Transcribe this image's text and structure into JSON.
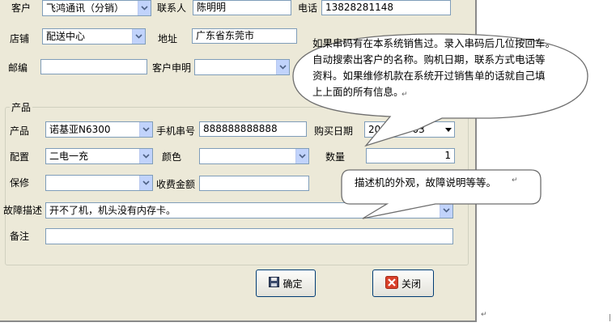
{
  "form": {
    "customer_label": "客户",
    "customer_value": "飞鸿通讯（分销）",
    "contact_label": "联系人",
    "contact_value": "陈明明",
    "phone_label": "电话",
    "phone_value": "13828281148",
    "store_label": "店铺",
    "store_value": "配送中心",
    "address_label": "地址",
    "address_value": "广东省东莞市",
    "zip_label": "邮编",
    "zip_value": "",
    "claim_label": "客户申明",
    "claim_value": ""
  },
  "product": {
    "group_title": "产品",
    "product_label": "产品",
    "product_value": "诺基亚N6300",
    "serial_label": "手机串号",
    "serial_value": "888888888888",
    "buy_date_label": "购买日期",
    "buy_date_value": "2010-04-03",
    "config_label": "配置",
    "config_value": "二电一充",
    "color_label": "颜色",
    "color_value": "",
    "qty_label": "数量",
    "qty_value": "1",
    "warranty_label": "保修",
    "warranty_value": "",
    "fee_label": "收费金额",
    "fee_value": "",
    "fault_label": "故障描述",
    "fault_value": "开不了机，机头没有内存卡。",
    "remark_label": "备注",
    "remark_value": ""
  },
  "buttons": {
    "ok_label": "确定",
    "close_label": "关闭"
  },
  "callouts": {
    "top_lines": [
      "如果串码有在本系统销售过。录入串码后几位按回车。",
      "自动搜索出客户的名称。购机日期，联系方式电话等",
      "资料。如果维修机款在系统开过销售单的话就自己填",
      "上上面的所有信息。"
    ],
    "bottom_text": "描述机的外观，故障说明等等。"
  },
  "colors": {
    "window_bg": "#ece9d8",
    "field_border": "#7f9db9",
    "button_border": "#003c74",
    "close_icon": "#d9412b"
  }
}
